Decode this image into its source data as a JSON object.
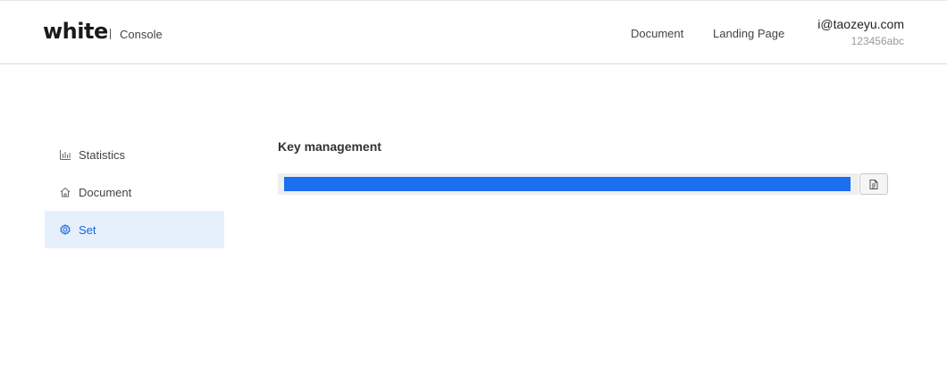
{
  "header": {
    "logo": "white",
    "subtitle": "Console",
    "nav": [
      {
        "label": "Document"
      },
      {
        "label": "Landing Page"
      }
    ],
    "user": {
      "email": "i@taozeyu.com",
      "id": "123456abc"
    }
  },
  "sidebar": {
    "items": [
      {
        "label": "Statistics",
        "icon": "bar-chart-icon",
        "active": false
      },
      {
        "label": "Document",
        "icon": "home-icon",
        "active": false
      },
      {
        "label": "Set",
        "icon": "gear-icon",
        "active": true
      }
    ]
  },
  "main": {
    "title": "Key management",
    "key_value": "",
    "copy_icon": "copy-icon"
  },
  "colors": {
    "accent": "#1565d8",
    "active_bg": "#e6f0fd",
    "key_highlight": "#1a6ef0"
  }
}
